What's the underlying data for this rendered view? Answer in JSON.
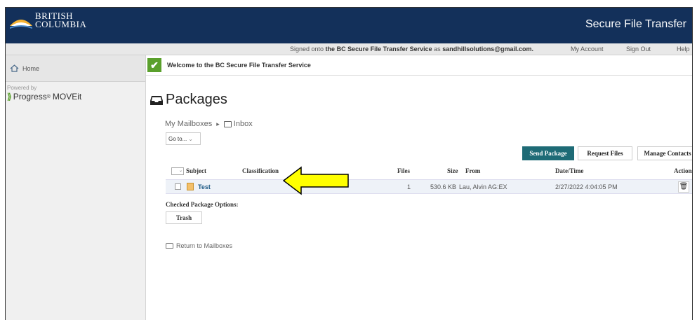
{
  "header": {
    "logo_text_line1": "BRITISH",
    "logo_text_line2": "COLUMBIA",
    "app_title": "Secure File Transfer"
  },
  "subbar": {
    "signed_prefix": "Signed onto",
    "service_name": "the BC Secure File Transfer Service",
    "as_word": "as",
    "email": "sandhillsolutions@gmail.com.",
    "my_account": "My Account",
    "sign_out": "Sign Out",
    "help": "Help"
  },
  "sidebar": {
    "home": "Home",
    "powered_by": "Powered by",
    "product_brand": "Progress",
    "product_name": "MOVEit",
    "product_tm": "®"
  },
  "welcome": {
    "message": "Welcome to the BC Secure File Transfer Service"
  },
  "page": {
    "title": "Packages",
    "breadcrumb_root": "My Mailboxes",
    "breadcrumb_sep": "▸",
    "breadcrumb_current": "Inbox",
    "goto_label": "Go to...",
    "send_package": "Send Package",
    "request_files": "Request Files",
    "manage_contacts": "Manage Contacts"
  },
  "table": {
    "columns": {
      "subject": "Subject",
      "classification": "Classification",
      "files": "Files",
      "size": "Size",
      "from": "From",
      "datetime": "Date/Time",
      "actions": "Actions"
    },
    "rows": [
      {
        "subject": "Test",
        "classification": "",
        "files": "1",
        "size": "530.6 KB",
        "from": "Lau, Alvin AG:EX",
        "datetime": "2/27/2022 4:04:05 PM"
      }
    ]
  },
  "options": {
    "label": "Checked Package Options:",
    "trash": "Trash"
  },
  "return_link": "Return to Mailboxes",
  "colors": {
    "topbar": "#13305a",
    "primary_button": "#1e6b76",
    "welcome_check": "#5aa02c",
    "arrow_fill": "#ffff00"
  }
}
